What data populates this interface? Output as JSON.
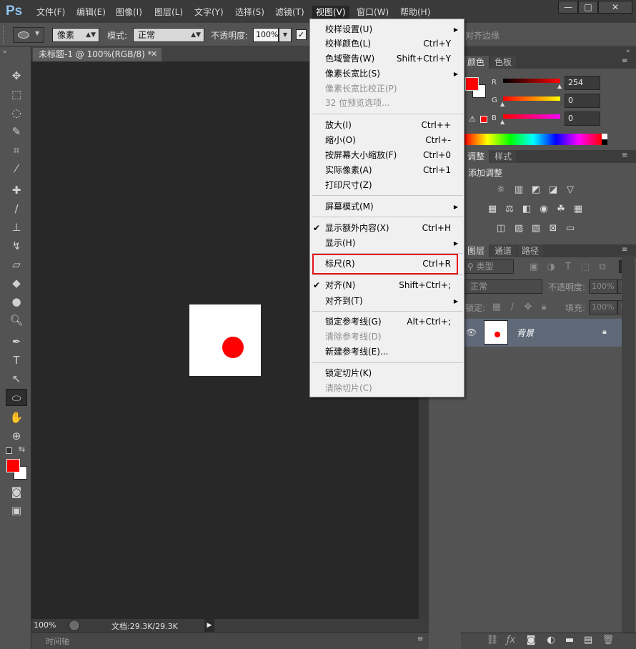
{
  "app": {
    "logo": "Ps"
  },
  "menubar": {
    "items": [
      "文件(F)",
      "编辑(E)",
      "图像(I)",
      "图层(L)",
      "文字(Y)",
      "选择(S)",
      "滤镜(T)",
      "视图(V)",
      "窗口(W)",
      "帮助(H)"
    ],
    "active": "视图(V)"
  },
  "window_controls": {
    "minimize": "—",
    "maximize": "□",
    "close": "✕"
  },
  "options": {
    "shape_mode": "像素",
    "mode_label": "模式:",
    "mode_value": "正常",
    "opacity_label": "不透明度:",
    "opacity_value": "100%",
    "antialias_label": "对齐边缘"
  },
  "document": {
    "tab_title": "未标题-1 @ 100%(RGB/8) *",
    "zoom": "100%",
    "doc_info": "文档:29.3K/29.3K",
    "canvas_color": "#ffffff",
    "dot_color": "#ff0000"
  },
  "timeline": {
    "label": "时间轴"
  },
  "colors": {
    "foreground": "#ff0000",
    "background": "#ffffff"
  },
  "color_panel": {
    "tabs": [
      "颜色",
      "色板"
    ],
    "r_label": "R",
    "r_value": "254",
    "g_label": "G",
    "g_value": "0",
    "b_label": "B",
    "b_value": "0"
  },
  "adjust_panel": {
    "tabs": [
      "调整",
      "样式"
    ],
    "title": "添加调整"
  },
  "layers_panel": {
    "tabs": [
      "图层",
      "通道",
      "路径"
    ],
    "filter_label": "类型",
    "blend_mode": "正常",
    "opacity_label": "不透明度:",
    "opacity_value": "100%",
    "lock_label": "锁定:",
    "fill_label": "填充:",
    "fill_value": "100%",
    "layer_name": "背景"
  },
  "view_menu": {
    "items": [
      {
        "label": "校样设置(U)",
        "shortcut": "",
        "disabled": false,
        "submenu": true
      },
      {
        "label": "校样颜色(L)",
        "shortcut": "Ctrl+Y",
        "disabled": false
      },
      {
        "label": "色域警告(W)",
        "shortcut": "Shift+Ctrl+Y",
        "disabled": false
      },
      {
        "label": "像素长宽比(S)",
        "shortcut": "",
        "disabled": false,
        "submenu": true
      },
      {
        "label": "像素长宽比校正(P)",
        "shortcut": "",
        "disabled": true
      },
      {
        "label": "32 位预览选项...",
        "shortcut": "",
        "disabled": true
      },
      {
        "label": "放大(I)",
        "shortcut": "Ctrl++",
        "disabled": false
      },
      {
        "label": "缩小(O)",
        "shortcut": "Ctrl+-",
        "disabled": false
      },
      {
        "label": "按屏幕大小缩放(F)",
        "shortcut": "Ctrl+0",
        "disabled": false
      },
      {
        "label": "实际像素(A)",
        "shortcut": "Ctrl+1",
        "disabled": false
      },
      {
        "label": "打印尺寸(Z)",
        "shortcut": "",
        "disabled": false
      },
      {
        "label": "屏幕模式(M)",
        "shortcut": "",
        "disabled": false,
        "submenu": true
      },
      {
        "label": "显示额外内容(X)",
        "shortcut": "Ctrl+H",
        "disabled": false,
        "checked": true
      },
      {
        "label": "显示(H)",
        "shortcut": "",
        "disabled": false,
        "submenu": true
      },
      {
        "label": "标尺(R)",
        "shortcut": "Ctrl+R",
        "disabled": false,
        "highlighted": true
      },
      {
        "label": "对齐(N)",
        "shortcut": "Shift+Ctrl+;",
        "disabled": false,
        "checked": true
      },
      {
        "label": "对齐到(T)",
        "shortcut": "",
        "disabled": false,
        "submenu": true
      },
      {
        "label": "锁定参考线(G)",
        "shortcut": "Alt+Ctrl+;",
        "disabled": false
      },
      {
        "label": "清除参考线(D)",
        "shortcut": "",
        "disabled": true
      },
      {
        "label": "新建参考线(E)...",
        "shortcut": "",
        "disabled": false
      },
      {
        "label": "锁定切片(K)",
        "shortcut": "",
        "disabled": false
      },
      {
        "label": "清除切片(C)",
        "shortcut": "",
        "disabled": true
      }
    ]
  }
}
